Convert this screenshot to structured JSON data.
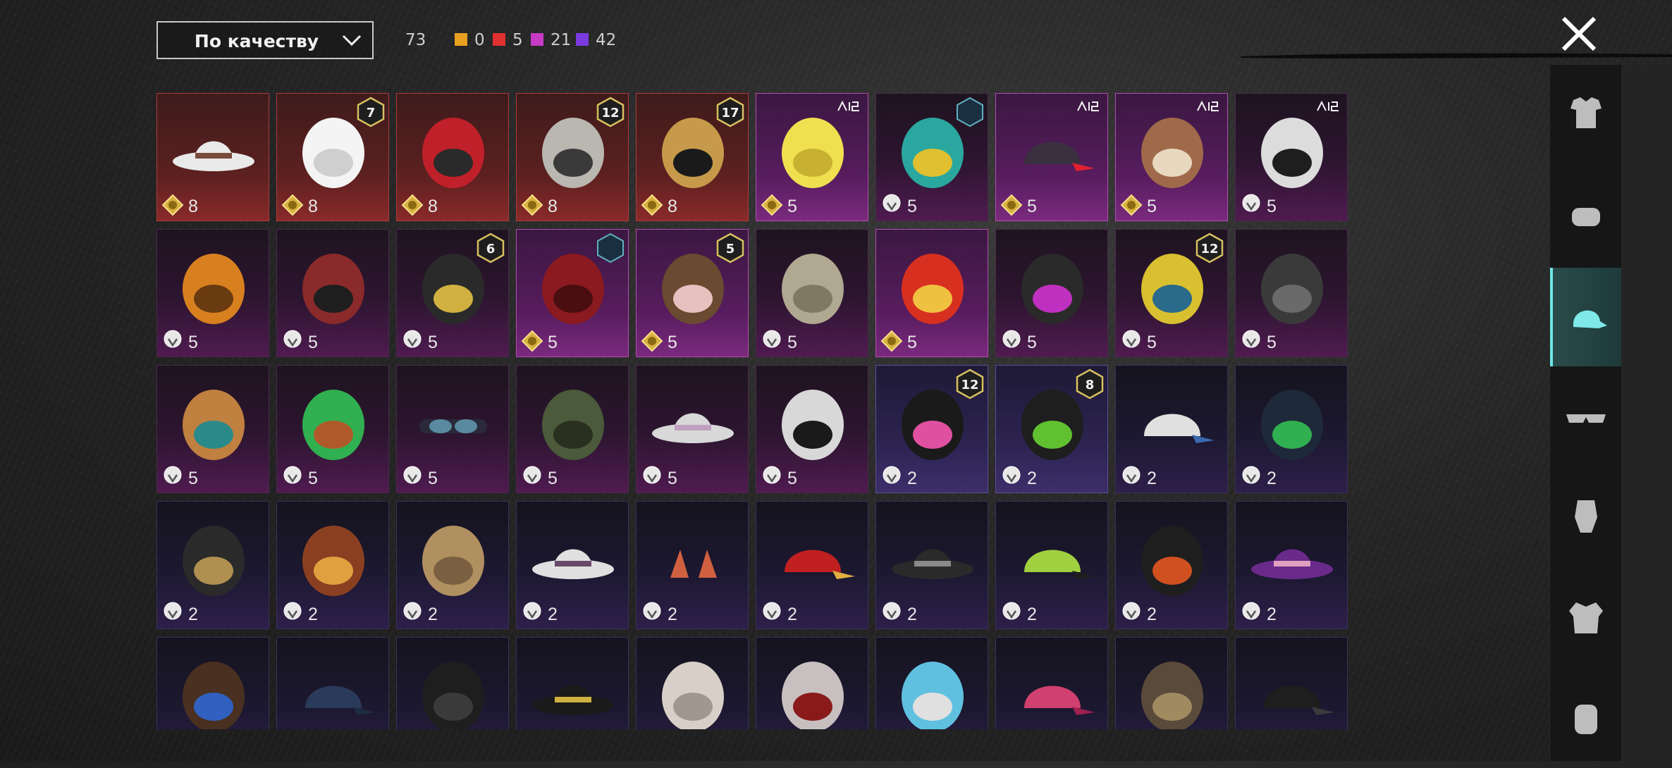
{
  "sort": {
    "label": "По качеству",
    "icon": "chevron-down-icon"
  },
  "counts": {
    "total": "73",
    "items": [
      {
        "color": "#e8a020",
        "value": "0"
      },
      {
        "color": "#e03030",
        "value": "5"
      },
      {
        "color": "#c63ac6",
        "value": "21"
      },
      {
        "color": "#7a3ae0",
        "value": "42"
      }
    ]
  },
  "close_icon": "close-icon",
  "tiles": [
    {
      "value": "8",
      "currency": "gold",
      "tier": "legendary",
      "art": "cowboy-hat"
    },
    {
      "value": "8",
      "currency": "gold",
      "tier": "legendary",
      "art": "white-wig",
      "badge": "7"
    },
    {
      "value": "8",
      "currency": "gold",
      "tier": "legendary",
      "art": "red-helmet"
    },
    {
      "value": "8",
      "currency": "gold",
      "tier": "legendary",
      "art": "winged-helmet",
      "badge": "12"
    },
    {
      "value": "8",
      "currency": "gold",
      "tier": "legendary",
      "art": "antler-mask",
      "badge": "17"
    },
    {
      "value": "5",
      "currency": "gold",
      "tier": "epic-hi",
      "art": "yellow-box-head",
      "logo": "PG"
    },
    {
      "value": "5",
      "currency": "silver",
      "tier": "epic",
      "art": "cat-helmet",
      "logo": "C"
    },
    {
      "value": "5",
      "currency": "gold",
      "tier": "epic-hi",
      "art": "cap-glasses",
      "logo": "PG"
    },
    {
      "value": "5",
      "currency": "gold",
      "tier": "epic-hi",
      "art": "bull-head",
      "logo": "PG"
    },
    {
      "value": "5",
      "currency": "silver",
      "tier": "epic",
      "art": "panda-head",
      "logo": "PG"
    },
    {
      "value": "5",
      "currency": "silver",
      "tier": "epic",
      "art": "pumpkin"
    },
    {
      "value": "5",
      "currency": "silver",
      "tier": "epic",
      "art": "wolf-mask"
    },
    {
      "value": "5",
      "currency": "silver",
      "tier": "epic",
      "art": "dark-helmet",
      "badge": "6"
    },
    {
      "value": "5",
      "currency": "gold",
      "tier": "epic-hi",
      "art": "red-hood",
      "logo": "C"
    },
    {
      "value": "5",
      "currency": "gold",
      "tier": "epic-hi",
      "art": "brown-wig",
      "badge": "5"
    },
    {
      "value": "5",
      "currency": "silver",
      "tier": "epic",
      "art": "grey-wig"
    },
    {
      "value": "5",
      "currency": "gold",
      "tier": "epic-hi",
      "art": "dragon-mask"
    },
    {
      "value": "5",
      "currency": "silver",
      "tier": "epic",
      "art": "purple-helmet"
    },
    {
      "value": "5",
      "currency": "silver",
      "tier": "epic",
      "art": "yellow-mech",
      "badge": "12"
    },
    {
      "value": "5",
      "currency": "silver",
      "tier": "epic",
      "art": "spike-helmet"
    },
    {
      "value": "5",
      "currency": "silver",
      "tier": "epic",
      "art": "camel-head"
    },
    {
      "value": "5",
      "currency": "silver",
      "tier": "epic",
      "art": "frog-head"
    },
    {
      "value": "5",
      "currency": "silver",
      "tier": "epic",
      "art": "goggles"
    },
    {
      "value": "5",
      "currency": "silver",
      "tier": "epic",
      "art": "army-helmet"
    },
    {
      "value": "5",
      "currency": "silver",
      "tier": "epic",
      "art": "bucket-hat"
    },
    {
      "value": "5",
      "currency": "silver",
      "tier": "epic",
      "art": "skull-mask"
    },
    {
      "value": "2",
      "currency": "silver",
      "tier": "rare-hi",
      "art": "bunny-ears-helmet",
      "badge": "12"
    },
    {
      "value": "2",
      "currency": "silver",
      "tier": "rare-hi",
      "art": "alien-wig",
      "badge": "8"
    },
    {
      "value": "2",
      "currency": "silver",
      "tier": "rare",
      "art": "baseball-cap"
    },
    {
      "value": "2",
      "currency": "silver",
      "tier": "rare",
      "art": "gas-helmet"
    },
    {
      "value": "2",
      "currency": "silver",
      "tier": "rare",
      "art": "moto-helmet"
    },
    {
      "value": "2",
      "currency": "silver",
      "tier": "rare",
      "art": "aviator-cap"
    },
    {
      "value": "2",
      "currency": "silver",
      "tier": "rare",
      "art": "straw-wig"
    },
    {
      "value": "2",
      "currency": "silver",
      "tier": "rare",
      "art": "sun-hat"
    },
    {
      "value": "2",
      "currency": "silver",
      "tier": "rare",
      "art": "cat-ears"
    },
    {
      "value": "2",
      "currency": "silver",
      "tier": "rare",
      "art": "red-cap"
    },
    {
      "value": "2",
      "currency": "silver",
      "tier": "rare",
      "art": "witch-hat"
    },
    {
      "value": "2",
      "currency": "silver",
      "tier": "rare",
      "art": "green-cap"
    },
    {
      "value": "2",
      "currency": "silver",
      "tier": "rare",
      "art": "dreadlocks"
    },
    {
      "value": "2",
      "currency": "silver",
      "tier": "rare",
      "art": "purple-top-hat"
    },
    {
      "value": "",
      "currency": "",
      "tier": "rare",
      "art": "brown-hair"
    },
    {
      "value": "",
      "currency": "",
      "tier": "rare",
      "art": "navy-cap"
    },
    {
      "value": "",
      "currency": "",
      "tier": "rare",
      "art": "gas-mask"
    },
    {
      "value": "",
      "currency": "",
      "tier": "rare",
      "art": "gold-band-hat"
    },
    {
      "value": "",
      "currency": "",
      "tier": "rare",
      "art": "turban"
    },
    {
      "value": "",
      "currency": "",
      "tier": "rare",
      "art": "demon-mask"
    },
    {
      "value": "",
      "currency": "",
      "tier": "rare",
      "art": "bunny-headband"
    },
    {
      "value": "",
      "currency": "",
      "tier": "rare",
      "art": "pink-beret"
    },
    {
      "value": "",
      "currency": "",
      "tier": "rare",
      "art": "goggle-helmet"
    },
    {
      "value": "",
      "currency": "",
      "tier": "rare",
      "art": "dark-cap"
    }
  ],
  "sidebar": [
    {
      "icon": "outfit-icon",
      "active": false
    },
    {
      "icon": "fist-icon",
      "active": false
    },
    {
      "icon": "cap-icon",
      "active": true
    },
    {
      "icon": "glasses-icon",
      "active": false
    },
    {
      "icon": "face-icon",
      "active": false
    },
    {
      "icon": "jacket-icon",
      "active": false
    },
    {
      "icon": "backpack-icon",
      "active": false
    }
  ]
}
